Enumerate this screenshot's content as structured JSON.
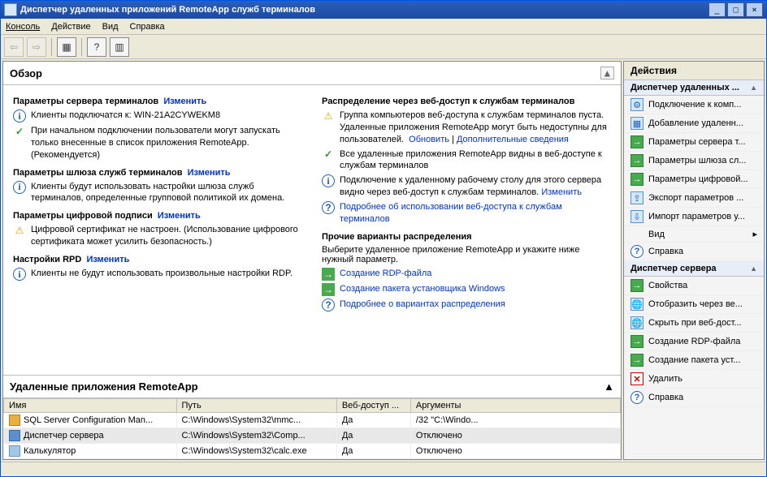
{
  "window": {
    "title": "Диспетчер удаленных приложений RemoteApp служб терминалов",
    "min": "_",
    "max": "□",
    "close": "×"
  },
  "menu": {
    "console": "Консоль",
    "action": "Действие",
    "view": "Вид",
    "help": "Справка"
  },
  "overview": {
    "title": "Обзор",
    "collapse": "▲",
    "left": {
      "params_ts": {
        "title": "Параметры сервера терминалов",
        "edit": "Изменить"
      },
      "connect": "Клиенты подключатся к: WIN-21A2CYWEKM8",
      "initial": "При начальном подключении пользователи могут запускать только внесенные в список приложения RemoteApp. (Рекомендуется)",
      "params_gw": {
        "title": "Параметры шлюза служб терминалов",
        "edit": "Изменить"
      },
      "gw_info": "Клиенты будут использовать настройки шлюза служб терминалов, определенные групповой политикой их домена.",
      "params_sig": {
        "title": "Параметры цифровой подписи",
        "edit": "Изменить"
      },
      "sig_warn": "Цифровой сертификат не настроен. (Использование цифрового сертификата может усилить безопасность.)",
      "rdp": {
        "title": "Настройки RPD",
        "edit": "Изменить"
      },
      "rdp_info": "Клиенты не будут использовать произвольные настройки RDP."
    },
    "right": {
      "dist_title": "Распределение через веб-доступ к службам терминалов",
      "warn_text": "Группа компьютеров веб-доступа к службам терминалов пуста. Удаленные приложения RemoteApp могут быть недоступны для пользователей.",
      "refresh": "Обновить",
      "more": "Дополнительные сведения",
      "all_visible": "Все удаленные приложения RemoteApp видны в веб-доступе к службам терминалов",
      "remote_desktop": "Подключение к удаленному рабочему столу для этого сервера видно через веб-доступ к службам терминалов.",
      "change": "Изменить",
      "help_link": "Подробнее об использовании веб-доступа к службам терминалов",
      "other_title": "Прочие варианты распределения",
      "other_desc": "Выберите удаленное приложение RemoteApp и укажите ниже нужный параметр.",
      "create_rdp": "Создание RDP-файла",
      "create_msi": "Создание пакета установщика Windows",
      "more_dist": "Подробнее о вариантах распределения"
    }
  },
  "remoteapps": {
    "title": "Удаленные приложения RemoteApp",
    "cols": {
      "name": "Имя",
      "path": "Путь",
      "web": "Веб-доступ ...",
      "args": "Аргументы"
    },
    "rows": [
      {
        "name": "SQL Server Configuration Man...",
        "path": "C:\\Windows\\System32\\mmc...",
        "web": "Да",
        "args": "/32 \"C:\\Windo..."
      },
      {
        "name": "Диспетчер сервера",
        "path": "C:\\Windows\\System32\\Comp...",
        "web": "Да",
        "args": "Отключено"
      },
      {
        "name": "Калькулятор",
        "path": "C:\\Windows\\System32\\calc.exe",
        "web": "Да",
        "args": "Отключено"
      }
    ]
  },
  "actions": {
    "title": "Действия",
    "group1": "Диспетчер удаленных ...",
    "g1": {
      "connect": "Подключение к комп...",
      "add": "Добавление удаленн...",
      "p_ts": "Параметры сервера т...",
      "p_gw": "Параметры шлюза сл...",
      "p_sig": "Параметры цифровой...",
      "export": "Экспорт параметров ...",
      "import": "Импорт параметров у...",
      "view": "Вид",
      "help": "Справка"
    },
    "group2": "Диспетчер сервера",
    "g2": {
      "props": "Свойства",
      "show_web": "Отобразить через ве...",
      "hide_web": "Скрыть при веб-дост...",
      "rdp": "Создание RDP-файла",
      "msi": "Создание пакета уст...",
      "del": "Удалить",
      "help": "Справка"
    }
  }
}
